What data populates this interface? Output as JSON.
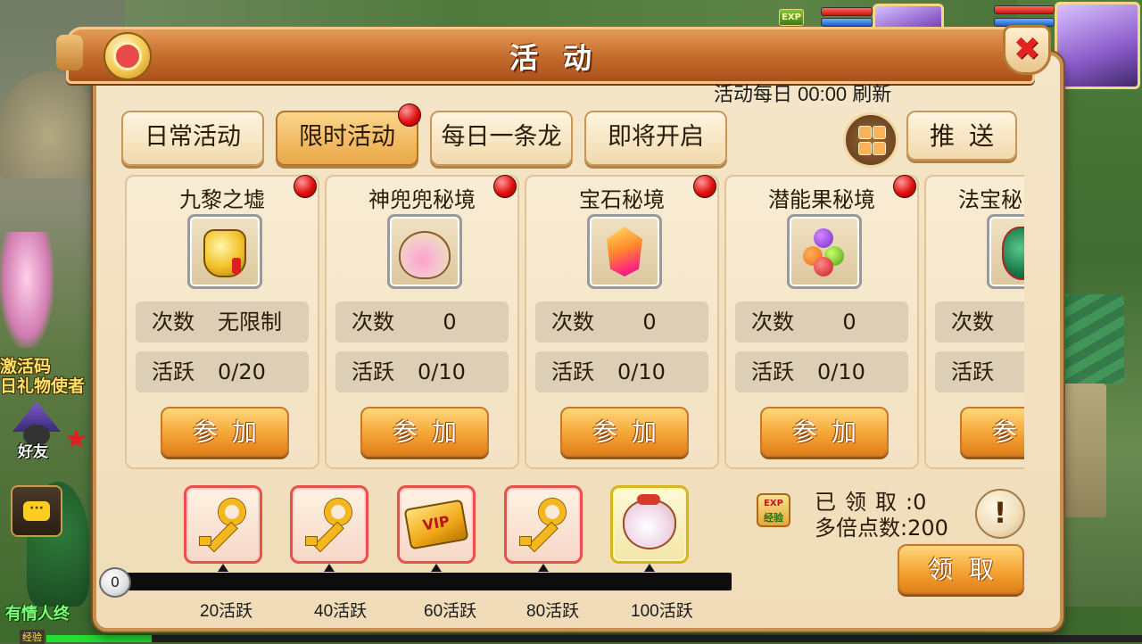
{
  "hud": {
    "exp_tag": "EXP"
  },
  "left_panel": {
    "activate_code": "激活码",
    "gift_envoy": "日礼物使者",
    "friend_label": "好友",
    "bottom_text": "有情人终",
    "exp_label": "经验",
    "chat_icon_text": "···"
  },
  "dialog": {
    "title": "活动",
    "refresh_note": "活动每日 00:00 刷新",
    "tabs": [
      {
        "label": "日常活动",
        "active": false
      },
      {
        "label": "限时活动",
        "active": true,
        "badge": true
      },
      {
        "label": "每日一条龙",
        "active": false
      },
      {
        "label": "即将开启",
        "active": false
      }
    ],
    "push_label": "推送",
    "count_label": "次数",
    "active_label": "活跃",
    "join_label": "参加",
    "activities": [
      {
        "name": "九黎之墟",
        "icon": "golden-lock-icon",
        "count": "无限制",
        "active": "0/20",
        "badge": true
      },
      {
        "name": "神兜兜秘境",
        "icon": "pink-pouch-icon",
        "count": "0",
        "active": "0/10",
        "badge": true
      },
      {
        "name": "宝石秘境",
        "icon": "gem-icon",
        "count": "0",
        "active": "0/10",
        "badge": true
      },
      {
        "name": "潜能果秘境",
        "icon": "fruit-icon",
        "count": "0",
        "active": "0/10",
        "badge": true
      },
      {
        "name": "法宝秘",
        "icon": "gourd-icon",
        "count": "",
        "active": "",
        "badge": false
      }
    ],
    "rewards": [
      {
        "icon": "golden-key-icon",
        "milestone": "20活跃",
        "tier": "red"
      },
      {
        "icon": "golden-key-icon",
        "milestone": "40活跃",
        "tier": "red"
      },
      {
        "icon": "vip-card-icon",
        "milestone": "60活跃",
        "tier": "red",
        "card_text": "VIP"
      },
      {
        "icon": "golden-key-icon",
        "milestone": "80活跃",
        "tier": "red"
      },
      {
        "icon": "gift-bag-icon",
        "milestone": "100活跃",
        "tier": "gold"
      }
    ],
    "progress": {
      "current": "0",
      "fraction": 0.0
    },
    "exp_icon": {
      "top": "EXP",
      "bottom": "经验"
    },
    "claimed_label": "已领取",
    "claimed_value": ":0",
    "multiplier_label": "多倍点数",
    "multiplier_value": ":200",
    "help_symbol": "!",
    "claim_label": "领取",
    "close_symbol": "✖"
  },
  "colors": {
    "dialog_bg": "#f0dcb8",
    "title_bar": "#c46b2b",
    "button_orange": "#f4a434",
    "badge_red": "#e01010",
    "reward_border_red": "#e8504a",
    "reward_border_gold": "#d8b420"
  }
}
